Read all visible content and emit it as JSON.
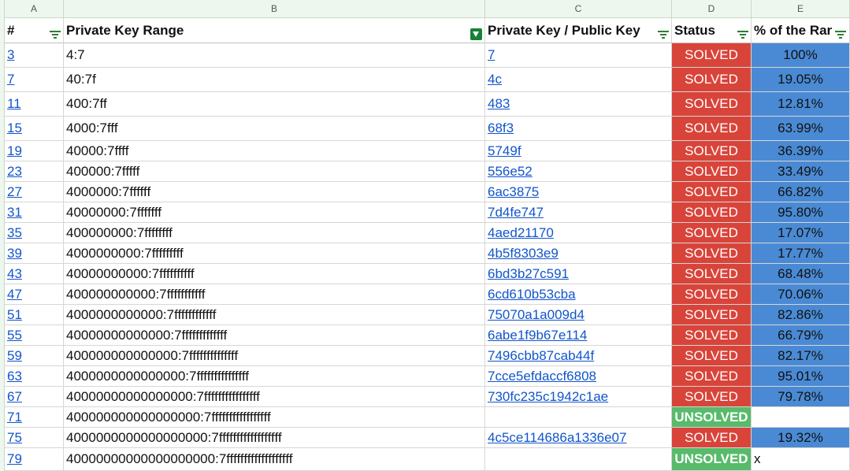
{
  "columns": [
    "A",
    "B",
    "C",
    "D",
    "E"
  ],
  "headers": {
    "num": "#",
    "range": "Private Key Range",
    "key": "Private Key / Public Key",
    "status": "Status",
    "pct": "% of the Rar"
  },
  "rows": [
    {
      "num": "3",
      "range": "4:7",
      "key": "7",
      "status": "SOLVED",
      "pct": "100%"
    },
    {
      "num": "7",
      "range": "40:7f",
      "key": "4c",
      "status": "SOLVED",
      "pct": "19.05%"
    },
    {
      "num": "11",
      "range": "400:7ff",
      "key": "483",
      "status": "SOLVED",
      "pct": "12.81%"
    },
    {
      "num": "15",
      "range": "4000:7fff",
      "key": "68f3",
      "status": "SOLVED",
      "pct": "63.99%"
    },
    {
      "num": "19",
      "range": "40000:7ffff",
      "key": "5749f",
      "status": "SOLVED",
      "pct": "36.39%"
    },
    {
      "num": "23",
      "range": "400000:7fffff",
      "key": "556e52",
      "status": "SOLVED",
      "pct": "33.49%"
    },
    {
      "num": "27",
      "range": "4000000:7ffffff",
      "key": "6ac3875",
      "status": "SOLVED",
      "pct": "66.82%"
    },
    {
      "num": "31",
      "range": "40000000:7fffffff",
      "key": "7d4fe747",
      "status": "SOLVED",
      "pct": "95.80%"
    },
    {
      "num": "35",
      "range": "400000000:7ffffffff",
      "key": "4aed21170",
      "status": "SOLVED",
      "pct": "17.07%"
    },
    {
      "num": "39",
      "range": "4000000000:7fffffffff",
      "key": "4b5f8303e9",
      "status": "SOLVED",
      "pct": "17.77%"
    },
    {
      "num": "43",
      "range": "40000000000:7ffffffffff",
      "key": "6bd3b27c591",
      "status": "SOLVED",
      "pct": "68.48%"
    },
    {
      "num": "47",
      "range": "400000000000:7fffffffffff",
      "key": "6cd610b53cba",
      "status": "SOLVED",
      "pct": "70.06%"
    },
    {
      "num": "51",
      "range": "4000000000000:7ffffffffffff",
      "key": "75070a1a009d4",
      "status": "SOLVED",
      "pct": "82.86%"
    },
    {
      "num": "55",
      "range": "40000000000000:7fffffffffffff",
      "key": "6abe1f9b67e114",
      "status": "SOLVED",
      "pct": "66.79%"
    },
    {
      "num": "59",
      "range": "400000000000000:7ffffffffffffff",
      "key": "7496cbb87cab44f",
      "status": "SOLVED",
      "pct": "82.17%"
    },
    {
      "num": "63",
      "range": "4000000000000000:7fffffffffffffff",
      "key": "7cce5efdaccf6808",
      "status": "SOLVED",
      "pct": "95.01%"
    },
    {
      "num": "67",
      "range": "40000000000000000:7ffffffffffffffff",
      "key": "730fc235c1942c1ae",
      "status": "SOLVED",
      "pct": "79.78%"
    },
    {
      "num": "71",
      "range": "400000000000000000:7fffffffffffffffff",
      "key": "",
      "status": "UNSOLVED",
      "pct": ""
    },
    {
      "num": "75",
      "range": "4000000000000000000:7ffffffffffffffffff",
      "key": "4c5ce114686a1336e07",
      "status": "SOLVED",
      "pct": "19.32%"
    },
    {
      "num": "79",
      "range": "40000000000000000000:7fffffffffffffffffff",
      "key": "",
      "status": "UNSOLVED",
      "pct": "x"
    }
  ],
  "colors": {
    "solved": "#d9443a",
    "unsolved": "#57bb6a",
    "percent": "#4a8ad4",
    "link": "#1155cc",
    "filter": "#2e7d32"
  },
  "icons": {
    "filter": "filter-lines-icon",
    "filter_active": "filter-active-icon"
  }
}
